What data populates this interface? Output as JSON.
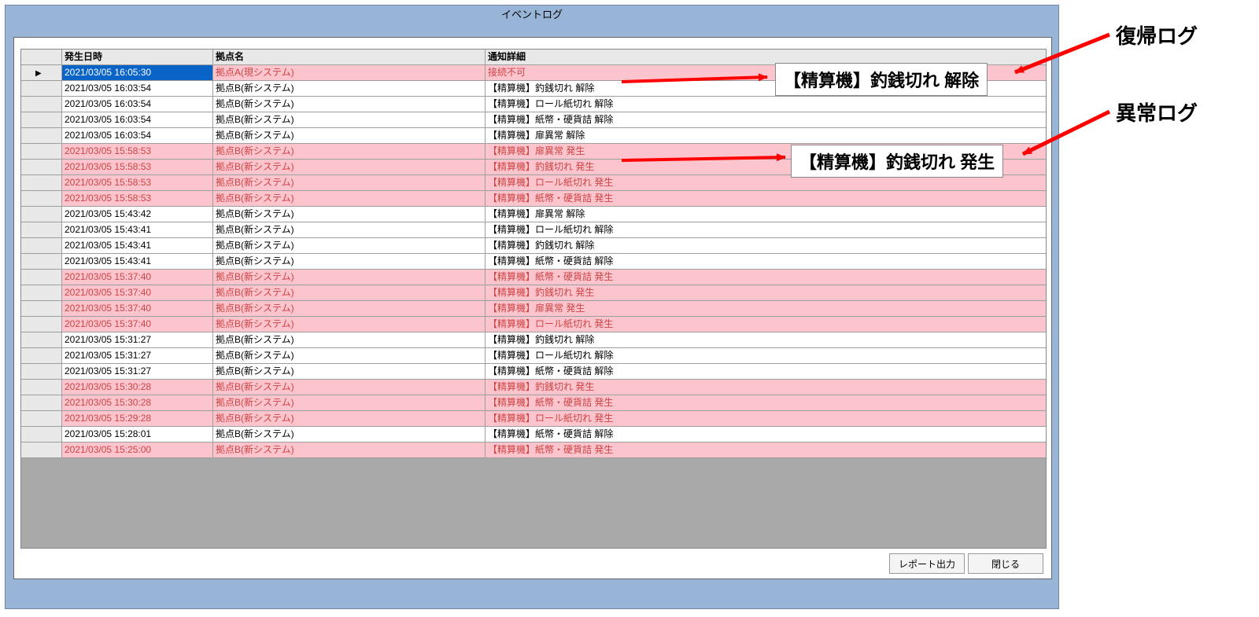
{
  "window": {
    "title": "イベントログ"
  },
  "headers": {
    "col0": "",
    "col1": "発生日時",
    "col2": "拠点名",
    "col3": "通知詳細"
  },
  "buttons": {
    "report": "レポート出力",
    "close": "閉じる"
  },
  "callouts": {
    "recovery_box": "【精算機】釣銭切れ 解除",
    "error_box": "【精算機】釣銭切れ 発生",
    "recovery_label": "復帰ログ",
    "error_label": "異常ログ"
  },
  "rows": [
    {
      "dt": "2021/03/05 16:05:30",
      "site": "拠点A(現システム)",
      "detail": "接続不可",
      "pink": true,
      "selected": true
    },
    {
      "dt": "2021/03/05 16:03:54",
      "site": "拠点B(新システム)",
      "detail": "【精算機】釣銭切れ 解除",
      "pink": false
    },
    {
      "dt": "2021/03/05 16:03:54",
      "site": "拠点B(新システム)",
      "detail": "【精算機】ロール紙切れ 解除",
      "pink": false
    },
    {
      "dt": "2021/03/05 16:03:54",
      "site": "拠点B(新システム)",
      "detail": "【精算機】紙幣・硬貨詰 解除",
      "pink": false
    },
    {
      "dt": "2021/03/05 16:03:54",
      "site": "拠点B(新システム)",
      "detail": "【精算機】扉異常 解除",
      "pink": false
    },
    {
      "dt": "2021/03/05 15:58:53",
      "site": "拠点B(新システム)",
      "detail": "【精算機】扉異常 発生",
      "pink": true
    },
    {
      "dt": "2021/03/05 15:58:53",
      "site": "拠点B(新システム)",
      "detail": "【精算機】釣銭切れ 発生",
      "pink": true
    },
    {
      "dt": "2021/03/05 15:58:53",
      "site": "拠点B(新システム)",
      "detail": "【精算機】ロール紙切れ 発生",
      "pink": true
    },
    {
      "dt": "2021/03/05 15:58:53",
      "site": "拠点B(新システム)",
      "detail": "【精算機】紙幣・硬貨詰 発生",
      "pink": true
    },
    {
      "dt": "2021/03/05 15:43:42",
      "site": "拠点B(新システム)",
      "detail": "【精算機】扉異常 解除",
      "pink": false
    },
    {
      "dt": "2021/03/05 15:43:41",
      "site": "拠点B(新システム)",
      "detail": "【精算機】ロール紙切れ 解除",
      "pink": false
    },
    {
      "dt": "2021/03/05 15:43:41",
      "site": "拠点B(新システム)",
      "detail": "【精算機】釣銭切れ 解除",
      "pink": false
    },
    {
      "dt": "2021/03/05 15:43:41",
      "site": "拠点B(新システム)",
      "detail": "【精算機】紙幣・硬貨詰 解除",
      "pink": false
    },
    {
      "dt": "2021/03/05 15:37:40",
      "site": "拠点B(新システム)",
      "detail": "【精算機】紙幣・硬貨詰 発生",
      "pink": true
    },
    {
      "dt": "2021/03/05 15:37:40",
      "site": "拠点B(新システム)",
      "detail": "【精算機】釣銭切れ 発生",
      "pink": true
    },
    {
      "dt": "2021/03/05 15:37:40",
      "site": "拠点B(新システム)",
      "detail": "【精算機】扉異常 発生",
      "pink": true
    },
    {
      "dt": "2021/03/05 15:37:40",
      "site": "拠点B(新システム)",
      "detail": "【精算機】ロール紙切れ 発生",
      "pink": true
    },
    {
      "dt": "2021/03/05 15:31:27",
      "site": "拠点B(新システム)",
      "detail": "【精算機】釣銭切れ 解除",
      "pink": false
    },
    {
      "dt": "2021/03/05 15:31:27",
      "site": "拠点B(新システム)",
      "detail": "【精算機】ロール紙切れ 解除",
      "pink": false
    },
    {
      "dt": "2021/03/05 15:31:27",
      "site": "拠点B(新システム)",
      "detail": "【精算機】紙幣・硬貨詰 解除",
      "pink": false
    },
    {
      "dt": "2021/03/05 15:30:28",
      "site": "拠点B(新システム)",
      "detail": "【精算機】釣銭切れ 発生",
      "pink": true
    },
    {
      "dt": "2021/03/05 15:30:28",
      "site": "拠点B(新システム)",
      "detail": "【精算機】紙幣・硬貨詰 発生",
      "pink": true
    },
    {
      "dt": "2021/03/05 15:29:28",
      "site": "拠点B(新システム)",
      "detail": "【精算機】ロール紙切れ 発生",
      "pink": true
    },
    {
      "dt": "2021/03/05 15:28:01",
      "site": "拠点B(新システム)",
      "detail": "【精算機】紙幣・硬貨詰 解除",
      "pink": false
    },
    {
      "dt": "2021/03/05 15:25:00",
      "site": "拠点B(新システム)",
      "detail": "【精算機】紙幣・硬貨詰 発生",
      "pink": true
    }
  ]
}
